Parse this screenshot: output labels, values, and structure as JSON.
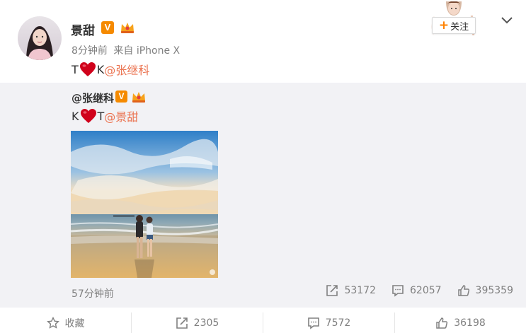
{
  "post": {
    "author": "景甜",
    "time": "8分钟前",
    "source": "来自 iPhone X",
    "text_prefix": "T",
    "text_middle": "K",
    "mention": "@张继科",
    "follow_label": "关注"
  },
  "repost": {
    "author": "@张继科",
    "text_prefix": "K",
    "text_middle": "T",
    "mention": "@景甜",
    "time": "57分钟前",
    "stats": {
      "reposts": "53172",
      "comments": "62057",
      "likes": "395359"
    }
  },
  "actions": {
    "favorite": "收藏",
    "repost": "2305",
    "comment": "7572",
    "like": "36198"
  },
  "badges": {
    "verified_mark": "V"
  },
  "icons": [
    "chevron-down-icon",
    "repost-icon",
    "comment-icon",
    "like-icon",
    "star-icon",
    "heart-icon",
    "crown-badge-icon"
  ],
  "colors": {
    "mention": "#eb7350",
    "verified": "#f58a00",
    "follow_plus": "#ff8200",
    "repost_bg": "#f2f2f5"
  }
}
